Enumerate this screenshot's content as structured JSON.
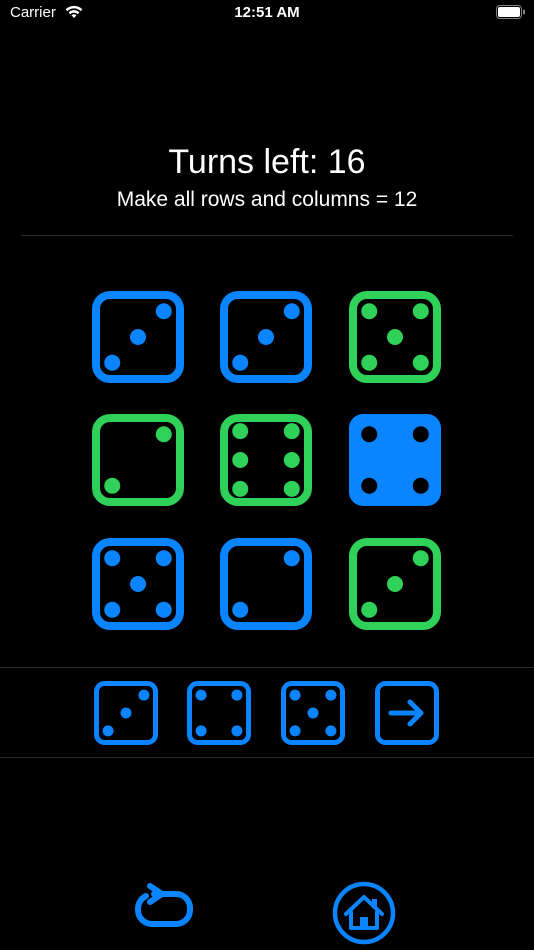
{
  "status": {
    "carrier": "Carrier",
    "time": "12:51 AM"
  },
  "game": {
    "turns_label": "Turns left: 16",
    "goal_label": "Make all rows and columns = 12"
  },
  "colors": {
    "blue": "#0a84ff",
    "green": "#30d158",
    "background": "#000000"
  },
  "board": [
    {
      "value": 3,
      "color": "blue",
      "filled": false
    },
    {
      "value": 3,
      "color": "blue",
      "filled": false
    },
    {
      "value": 5,
      "color": "green",
      "filled": false
    },
    {
      "value": 2,
      "color": "green",
      "filled": false
    },
    {
      "value": 6,
      "color": "green",
      "filled": false
    },
    {
      "value": 4,
      "color": "blue",
      "filled": true
    },
    {
      "value": 5,
      "color": "blue",
      "filled": false
    },
    {
      "value": 2,
      "color": "blue",
      "filled": false
    },
    {
      "value": 3,
      "color": "green",
      "filled": false
    }
  ],
  "tray": [
    {
      "value": 3
    },
    {
      "value": 4
    },
    {
      "value": 5
    },
    {
      "icon": "arrow-right-icon"
    }
  ],
  "bottom_buttons": [
    {
      "icon": "restart-icon"
    },
    {
      "icon": "home-icon"
    }
  ]
}
